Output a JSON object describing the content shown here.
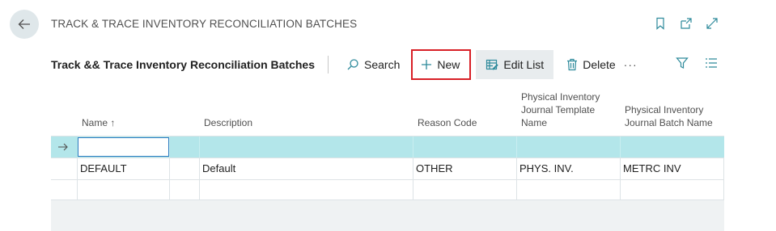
{
  "header": {
    "title": "TRACK & TRACE INVENTORY RECONCILIATION BATCHES",
    "icons": [
      "bookmark-icon",
      "open-new-window-icon",
      "expand-icon"
    ]
  },
  "toolbar": {
    "caption": "Track && Trace Inventory Reconciliation Batches",
    "search_label": "Search",
    "new_label": "New",
    "edit_list_label": "Edit List",
    "delete_label": "Delete",
    "more_label": "···"
  },
  "table": {
    "columns": [
      {
        "label": "Name ↑"
      },
      {
        "label": "Description"
      },
      {
        "label": "Reason Code"
      },
      {
        "label": "Physical Inventory Journal Template Name"
      },
      {
        "label": "Physical Inventory Journal Batch Name"
      }
    ],
    "rows": [
      {
        "name": "",
        "description": "",
        "reason_code": "",
        "template": "",
        "batch": ""
      },
      {
        "name": "DEFAULT",
        "description": "Default",
        "reason_code": "OTHER",
        "template": "PHYS. INV.",
        "batch": "METRC INV"
      },
      {
        "name": "",
        "description": "",
        "reason_code": "",
        "template": "",
        "batch": ""
      }
    ]
  },
  "colors": {
    "accent": "#2d7bc0",
    "selected_row": "#b3e6ea",
    "highlight_border": "#d81f26",
    "icon": "#2d8a9b"
  }
}
